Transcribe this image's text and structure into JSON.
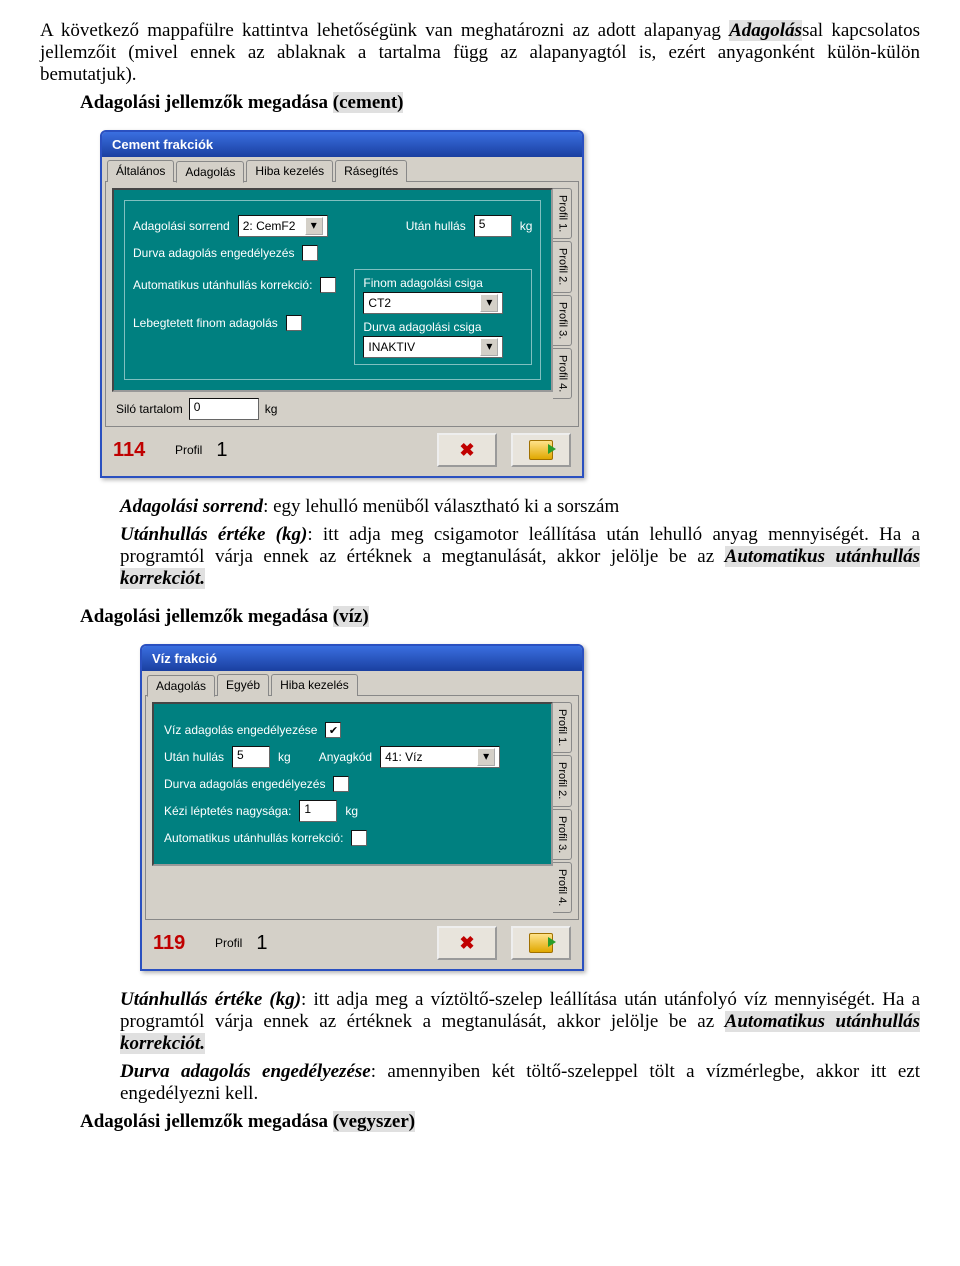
{
  "text": {
    "intro_a": "A következő mappafülre kattintva lehetőségünk van meghatározni az adott alapanyag ",
    "intro_adagolas": "Adagolás",
    "intro_b": "sal kapcsolatos jellemzőit (mivel ennek az ablaknak a tartalma függ az alapanyagtól is, ezért anyagonként külön-külön bemutatjuk).",
    "heading_cement_a": "Adagolási jellemzők megadása ",
    "heading_cement_b": "(cement)",
    "desc_sorrend_lbl": "Adagolási sorrend",
    "desc_sorrend_txt": ": egy lehulló menüből választható ki a sorszám",
    "desc_utan_lbl": "Utánhullás értéke (kg)",
    "desc_utan_txt_a": ": itt adja meg csigamotor leállítása után lehulló anyag mennyiségét. Ha a programtól várja ennek az értéknek a megtanulását, akkor jelölje be az ",
    "desc_auto": "Automatikus utánhullás korrekciót.",
    "heading_viz_a": "Adagolási jellemzők megadása ",
    "heading_viz_b": "(víz)",
    "desc_utan2_lbl": "Utánhullás értéke (kg)",
    "desc_utan2_txt_a": ": itt adja meg a víztöltő-szelep  leállítása után utánfolyó víz mennyiségét. Ha a programtól várja ennek az értéknek a megtanulását, akkor jelölje be az ",
    "desc_durva_lbl": "Durva adagolás engedélyezése",
    "desc_durva_txt": ": amennyiben két töltő-szeleppel tölt a vízmérlegbe, akkor itt ezt engedélyezni kell.",
    "heading_vegyszer_a": "Adagolási jellemzők megadása ",
    "heading_vegyszer_b": "(vegyszer)"
  },
  "cement": {
    "title": "Cement frakciók",
    "tabs": [
      "Általános",
      "Adagolás",
      "Hiba kezelés",
      "Rásegítés"
    ],
    "active_tab": "Adagolás",
    "vtabs": [
      "Profil 1.",
      "Profil 2.",
      "Profil 3.",
      "Profil 4."
    ],
    "labels": {
      "sorrend": "Adagolási sorrend",
      "utan_hullas": "Után hullás",
      "kg": "kg",
      "durva": "Durva adagolás engedélyezés",
      "auto": "Automatikus utánhullás korrekció:",
      "lebeg": "Lebegtetett finom adagolás",
      "finom_csiga": "Finom adagolási csiga",
      "durva_csiga": "Durva adagolási csiga",
      "silo": "Siló tartalom",
      "profil": "Profil"
    },
    "values": {
      "sorrend": "2: CemF2",
      "utan_hullas": "5",
      "finom_csiga": "CT2",
      "durva_csiga": "INAKTIV",
      "silo": "0",
      "profil": "1",
      "id": "114"
    }
  },
  "viz": {
    "title": "Víz frakció",
    "tabs": [
      "Adagolás",
      "Egyéb",
      "Hiba kezelés"
    ],
    "active_tab": "Adagolás",
    "vtabs": [
      "Profil 1.",
      "Profil 2.",
      "Profil 3.",
      "Profil 4."
    ],
    "labels": {
      "enged": "Víz adagolás engedélyezése",
      "utan_hullas": "Után hullás",
      "kg": "kg",
      "anyagkod": "Anyagkód",
      "durva": "Durva adagolás engedélyezés",
      "kezi": "Kézi léptetés nagysága:",
      "auto": "Automatikus utánhullás korrekció:",
      "profil": "Profil"
    },
    "values": {
      "utan_hullas": "5",
      "anyagkod": "41: Víz",
      "kezi": "1",
      "profil": "1",
      "id": "119",
      "enged_checked": "✔"
    }
  },
  "icons": {
    "cancel": "✖",
    "dropdown": "▾"
  }
}
